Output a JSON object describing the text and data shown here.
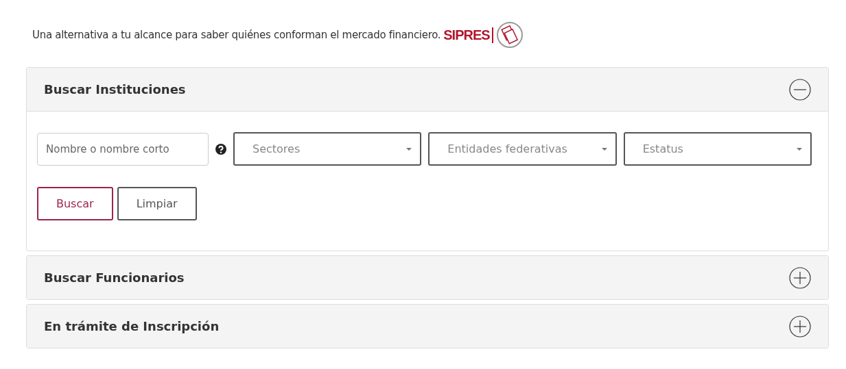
{
  "intro": {
    "text": "Una alternativa a tu alcance para saber quiénes conforman el mercado financiero.",
    "logo": "SIPRES"
  },
  "panels": [
    {
      "title": "Buscar Instituciones",
      "expanded": true,
      "search": {
        "placeholder": "Nombre o nombre corto"
      },
      "selects": [
        {
          "placeholder": "Sectores"
        },
        {
          "placeholder": "Entidades federativas"
        },
        {
          "placeholder": "Estatus"
        }
      ],
      "buttons": [
        {
          "label": "Buscar",
          "kind": "primary"
        },
        {
          "label": "Limpiar",
          "kind": "secondary"
        }
      ]
    },
    {
      "title": "Buscar Funcionarios",
      "expanded": false
    },
    {
      "title": "En trámite de Inscripción",
      "expanded": false
    }
  ]
}
